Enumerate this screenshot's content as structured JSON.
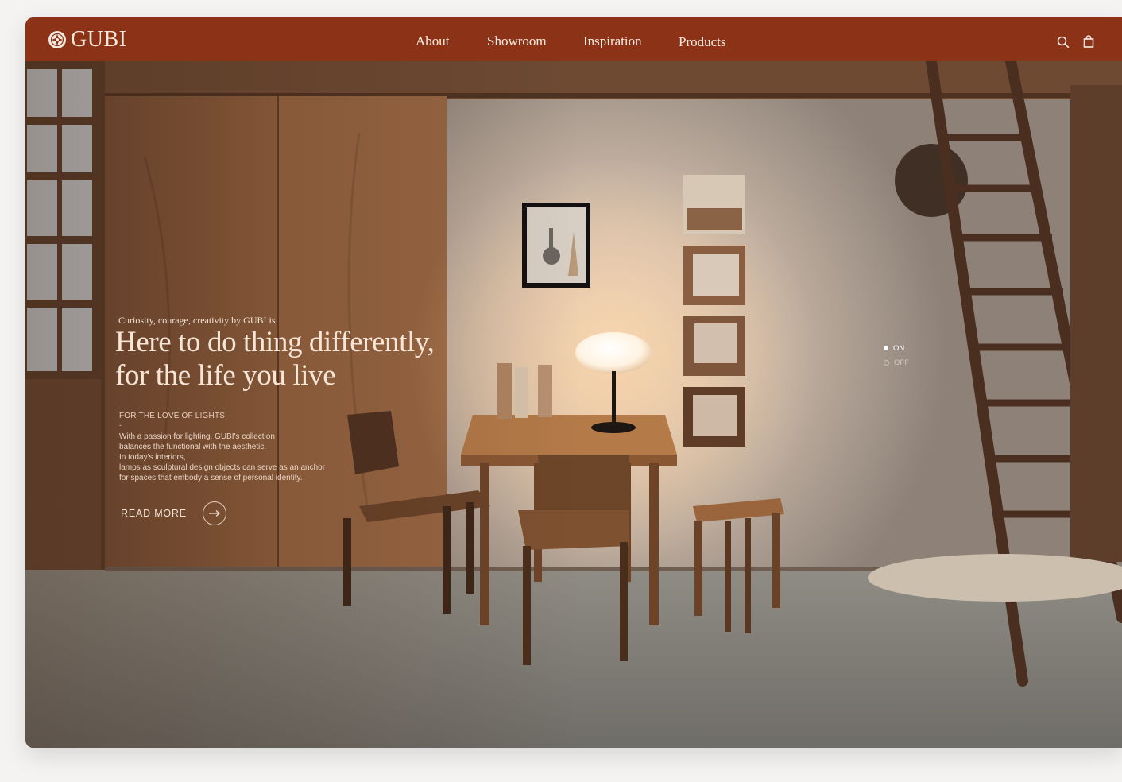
{
  "brand": {
    "name": "GUBI"
  },
  "nav": {
    "links": [
      "About",
      "Showroom",
      "Inspiration",
      "Products"
    ]
  },
  "header_icons": [
    "search-icon",
    "shopping-bag-icon"
  ],
  "hero": {
    "eyebrow": "Curiosity, courage, creativity by GUBI is",
    "headline_line1": "Here to do thing differently,",
    "headline_line2": "for the life you live",
    "section_label": "FOR THE LOVE OF LIGHTS",
    "dash": "-",
    "body_lines": [
      "With a passion for lighting, GUBI's collection",
      "balances the functional with the aesthetic.",
      "In today's interiors,",
      "lamps as sculptural design objects can serve as an anchor",
      "for spaces that embody a sense of personal identity."
    ],
    "cta_label": "READ MORE"
  },
  "light_toggle": {
    "options": [
      "ON",
      "OFF"
    ],
    "selected": "ON"
  },
  "colors": {
    "nav_background": "#8c3317",
    "nav_text": "#f8ece4",
    "hero_text": "#f7e6d8"
  }
}
